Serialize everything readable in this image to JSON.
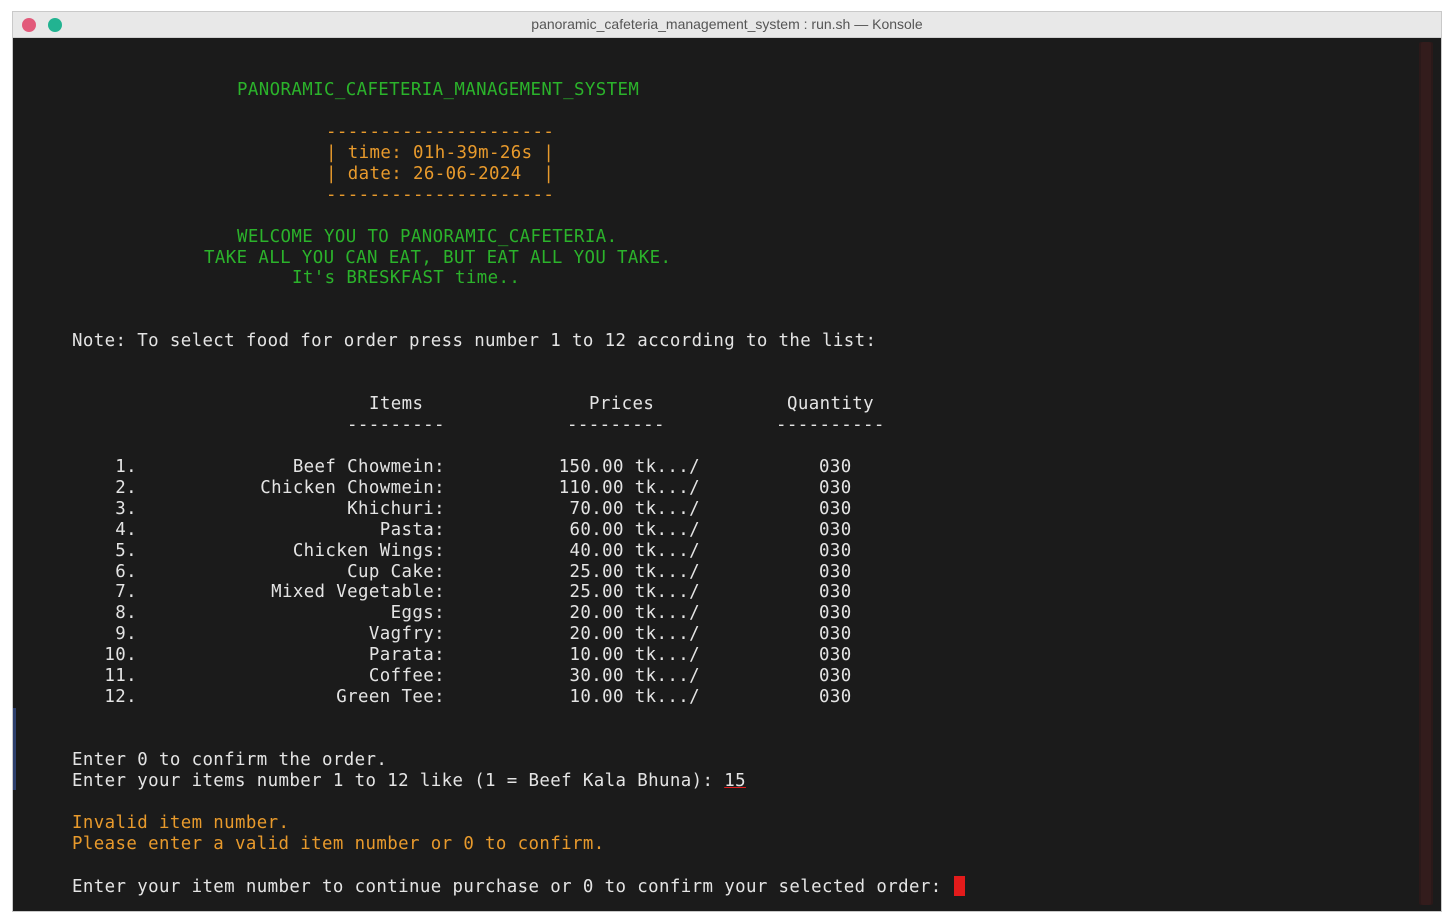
{
  "window": {
    "title": "panoramic_cafeteria_management_system : run.sh — Konsole"
  },
  "header": {
    "system_name": "PANORAMIC_CAFETERIA_MANAGEMENT_SYSTEM",
    "box_border": "---------------------",
    "time_line": "| time: 01h-39m-26s |",
    "date_line": "| date: 26-06-2024  |"
  },
  "welcome": {
    "line1": "WELCOME YOU TO PANORAMIC_CAFETERIA.",
    "line2": "TAKE ALL YOU CAN EAT, BUT EAT ALL YOU TAKE.",
    "line3": "It's BRESKFAST time.."
  },
  "note": "Note: To select food for order press number 1 to 12 according to the list:",
  "table": {
    "headers": {
      "items": "Items",
      "prices": "Prices",
      "quantity": "Quantity"
    },
    "underlines": {
      "items": "---------",
      "prices": "---------",
      "quantity": "----------"
    },
    "rows": [
      {
        "num": "1.",
        "item": "Beef Chowmein:",
        "price": "150.00 tk.../",
        "qty": "030"
      },
      {
        "num": "2.",
        "item": "Chicken Chowmein:",
        "price": "110.00 tk.../",
        "qty": "030"
      },
      {
        "num": "3.",
        "item": "Khichuri:",
        "price": "70.00 tk.../",
        "qty": "030"
      },
      {
        "num": "4.",
        "item": "Pasta:",
        "price": "60.00 tk.../",
        "qty": "030"
      },
      {
        "num": "5.",
        "item": "Chicken Wings:",
        "price": "40.00 tk.../",
        "qty": "030"
      },
      {
        "num": "6.",
        "item": "Cup Cake:",
        "price": "25.00 tk.../",
        "qty": "030"
      },
      {
        "num": "7.",
        "item": "Mixed Vegetable:",
        "price": "25.00 tk.../",
        "qty": "030"
      },
      {
        "num": "8.",
        "item": "Eggs:",
        "price": "20.00 tk.../",
        "qty": "030"
      },
      {
        "num": "9.",
        "item": "Vagfry:",
        "price": "20.00 tk.../",
        "qty": "030"
      },
      {
        "num": "10.",
        "item": "Parata:",
        "price": "10.00 tk.../",
        "qty": "030"
      },
      {
        "num": "11.",
        "item": "Coffee:",
        "price": "30.00 tk.../",
        "qty": "030"
      },
      {
        "num": "12.",
        "item": "Green Tee:",
        "price": "10.00 tk.../",
        "qty": "030"
      }
    ]
  },
  "prompts": {
    "confirm_hint": "Enter 0 to confirm the order.",
    "items_prompt": "Enter your items number 1 to 12 like (1 = Beef Kala Bhuna): ",
    "items_input": "15",
    "error1": "Invalid item number.",
    "error2": "Please enter a valid item number or 0 to confirm.",
    "continue_prompt": "Enter your item number to continue purchase or 0 to confirm your selected order: "
  },
  "colors": {
    "green": "#2bb32b",
    "orange": "#e89a2c",
    "text": "#e4e4e4",
    "background": "#1b1b1b",
    "cursor": "#e31b1b"
  }
}
